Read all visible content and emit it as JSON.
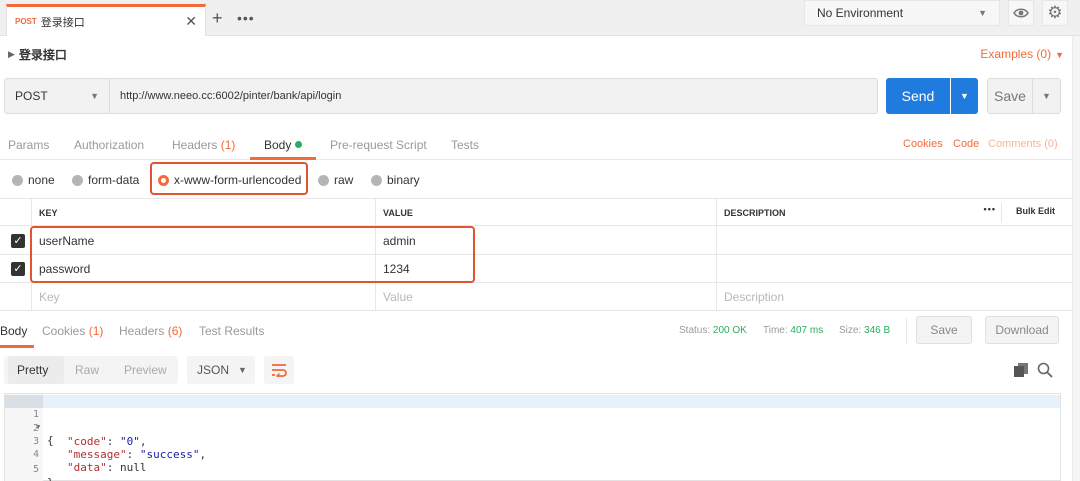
{
  "tab": {
    "method": "POST",
    "name": "登录接口",
    "close": "✕",
    "add": "+",
    "more": "•••"
  },
  "environment": {
    "selected": "No Environment"
  },
  "request": {
    "title": "登录接口",
    "examples_label": "Examples (0)",
    "method": "POST",
    "url": "http://www.neeo.cc:6002/pinter/bank/api/login",
    "send_label": "Send",
    "save_label": "Save"
  },
  "request_tabs": {
    "params": "Params",
    "authorization": "Authorization",
    "headers": "Headers",
    "headers_count": "(1)",
    "body": "Body",
    "pre_request": "Pre-request Script",
    "tests": "Tests",
    "cookies": "Cookies",
    "code": "Code",
    "comments": "Comments (0)"
  },
  "body_types": {
    "none": "none",
    "form_data": "form-data",
    "urlencoded": "x-www-form-urlencoded",
    "raw": "raw",
    "binary": "binary",
    "selected": "x-www-form-urlencoded"
  },
  "params_table": {
    "headers": {
      "key": "KEY",
      "value": "VALUE",
      "description": "DESCRIPTION"
    },
    "more": "•••",
    "bulk_edit": "Bulk Edit",
    "rows": [
      {
        "checked": true,
        "key": "userName",
        "value": "admin",
        "description": ""
      },
      {
        "checked": true,
        "key": "password",
        "value": "1234",
        "description": ""
      }
    ],
    "placeholders": {
      "key": "Key",
      "value": "Value",
      "description": "Description"
    }
  },
  "response_tabs": {
    "body": "Body",
    "cookies": "Cookies",
    "cookies_count": "(1)",
    "headers": "Headers",
    "headers_count": "(6)",
    "test_results": "Test Results"
  },
  "response_status": {
    "status_label": "Status:",
    "status_value": "200 OK",
    "time_label": "Time:",
    "time_value": "407 ms",
    "size_label": "Size:",
    "size_value": "346 B",
    "save_label": "Save",
    "download_label": "Download"
  },
  "format_toolbar": {
    "pretty": "Pretty",
    "raw": "Raw",
    "preview": "Preview",
    "format": "JSON"
  },
  "response_body": {
    "lines": [
      {
        "num": "1",
        "open": "{"
      },
      {
        "num": "2",
        "key": "\"code\"",
        "sep": ": ",
        "value": "\"0\"",
        "end": ","
      },
      {
        "num": "3",
        "key": "\"message\"",
        "sep": ": ",
        "value": "\"success\"",
        "end": ","
      },
      {
        "num": "4",
        "key": "\"data\"",
        "sep": ": ",
        "value": "null",
        "end": ""
      },
      {
        "num": "5",
        "open": "}"
      }
    ]
  },
  "colors": {
    "accent": "#f26b3a",
    "send_button": "#1f7cde",
    "status_ok": "#27ae60",
    "annotation_box": "#e0542f"
  }
}
